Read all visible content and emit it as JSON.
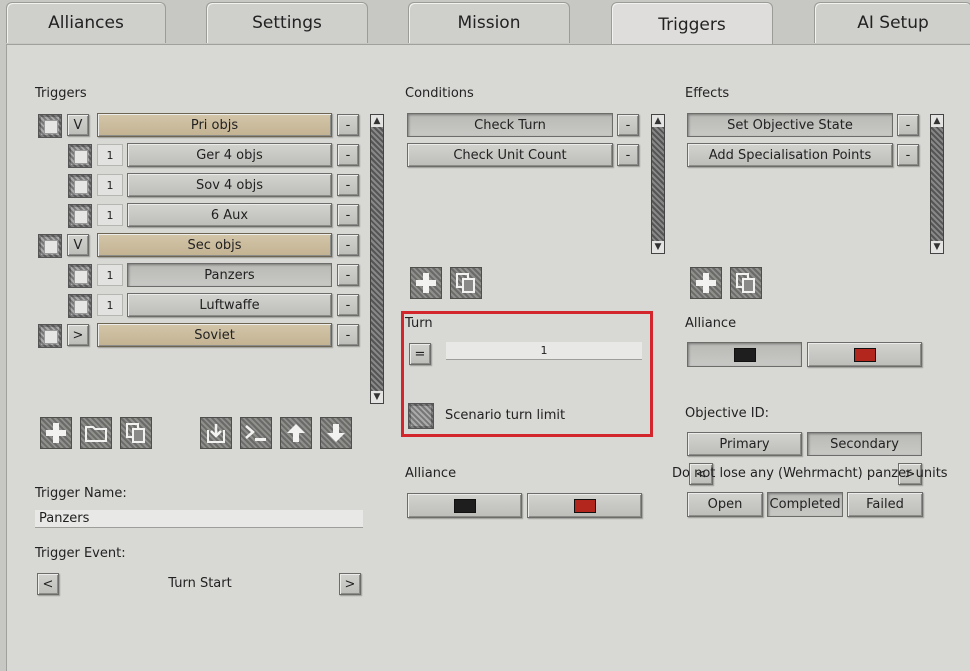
{
  "tabs": [
    "Alliances",
    "Settings",
    "Mission",
    "Triggers",
    "AI Setup"
  ],
  "triggers": {
    "header": "Triggers",
    "rows": [
      {
        "prefix": "V",
        "label": "Pri objs",
        "group": true
      },
      {
        "prefix": "1",
        "label": "Ger 4 objs",
        "group": false
      },
      {
        "prefix": "1",
        "label": "Sov 4 objs",
        "group": false
      },
      {
        "prefix": "1",
        "label": "6 Aux",
        "group": false
      },
      {
        "prefix": "V",
        "label": "Sec objs",
        "group": true
      },
      {
        "prefix": "1",
        "label": "Panzers",
        "group": false
      },
      {
        "prefix": "1",
        "label": "Luftwaffe",
        "group": false
      },
      {
        "prefix": ">",
        "label": "Soviet",
        "group": true
      }
    ],
    "remove_label": "-",
    "name_label": "Trigger Name:",
    "name_value": "Panzers",
    "event_label": "Trigger Event:",
    "event_value": "Turn Start",
    "prev": "<",
    "next": ">"
  },
  "conditions": {
    "header": "Conditions",
    "items": [
      "Check Turn",
      "Check Unit Count"
    ],
    "remove_label": "-",
    "turn_label": "Turn",
    "operator": "=",
    "turn_value": "1",
    "scenario_limit_label": "Scenario turn limit",
    "alliance_label": "Alliance",
    "alliance_colors": [
      "#1e1e1e",
      "#b3261e"
    ]
  },
  "effects": {
    "header": "Effects",
    "items": [
      "Set Objective State",
      "Add Specialisation Points"
    ],
    "remove_label": "-",
    "alliance_label": "Alliance",
    "alliance_colors": [
      "#1e1e1e",
      "#b3261e"
    ],
    "objective_label": "Objective ID:",
    "objective_types": [
      "Primary",
      "Secondary"
    ],
    "objective_text": "Do not lose any (Wehrmacht) panzer units",
    "objective_prev": "<",
    "objective_next": ">",
    "states": [
      "Open",
      "Completed",
      "Failed"
    ]
  }
}
